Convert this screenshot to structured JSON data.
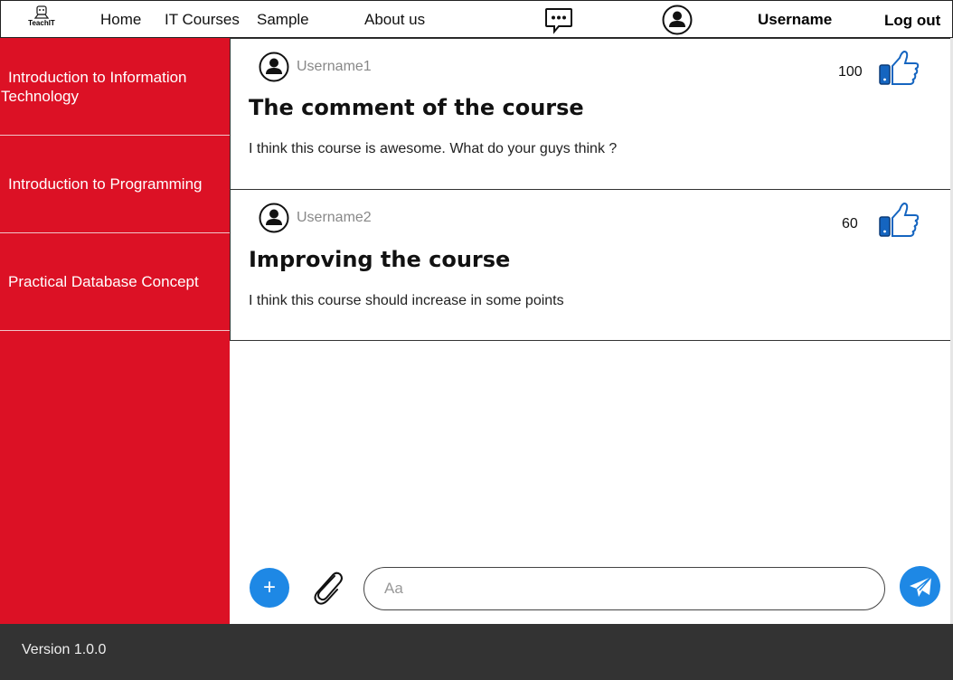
{
  "app": {
    "logo_text": "TeachIT"
  },
  "nav": {
    "items": [
      {
        "label": "Home"
      },
      {
        "label": "IT Courses"
      },
      {
        "label": "Sample"
      },
      {
        "label": "About us"
      }
    ],
    "username": "Username",
    "logout": "Log out"
  },
  "sidebar": {
    "items": [
      {
        "label_line1": "Introduction to Information",
        "label_line2": "Technology"
      },
      {
        "label_line1": "Introduction to Programming"
      },
      {
        "label_line1": "Practical Database Concept"
      }
    ]
  },
  "posts": [
    {
      "user": "Username1",
      "title": "The comment of the course",
      "body": "I think this course is awesome. What do your guys think ?",
      "likes": "100"
    },
    {
      "user": "Username2",
      "title": "Improving the course",
      "body": "I think this course should increase in some points",
      "likes": "60"
    }
  ],
  "composer": {
    "add_label": "+",
    "placeholder": "Aa"
  },
  "footer": {
    "version": "Version 1.0.0"
  },
  "colors": {
    "sidebar": "#dc1125",
    "accent": "#1e88e5",
    "footer": "#333333"
  }
}
